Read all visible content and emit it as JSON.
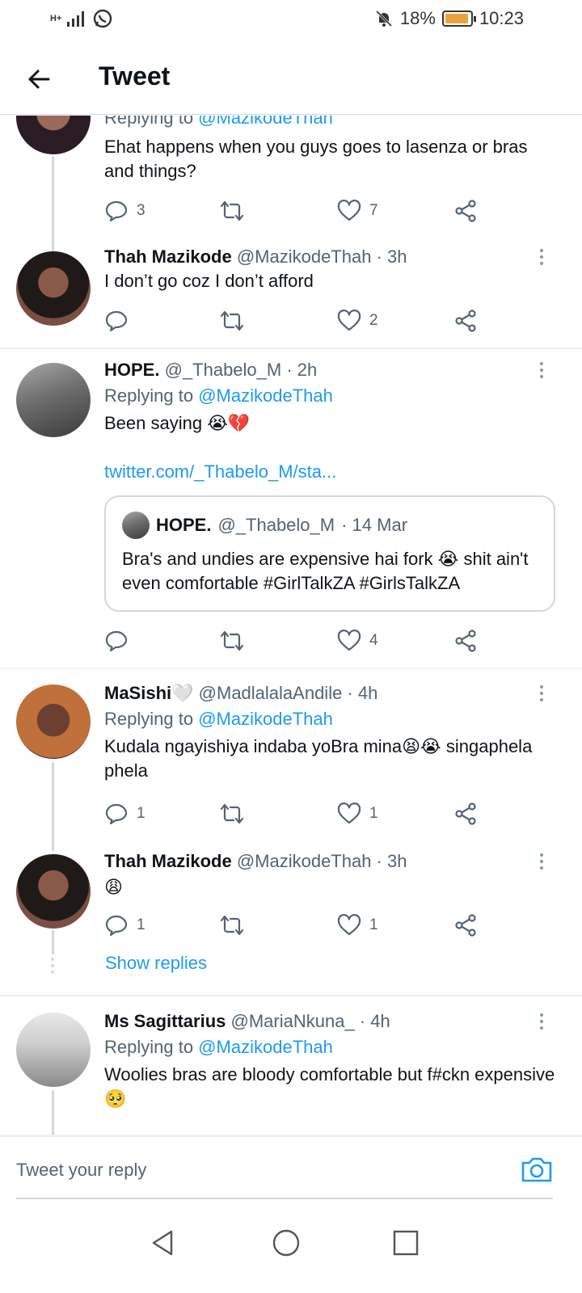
{
  "status_bar": {
    "network": "H+",
    "battery_percent": "18%",
    "time": "10:23"
  },
  "header": {
    "title": "Tweet"
  },
  "tweets": [
    {
      "replying_to": "Replying to",
      "replying_handle": "@MazikodeThah",
      "text": "Ehat happens when you guys goes to lasenza or bras and things?",
      "replies": "3",
      "retweets": "",
      "likes": "7"
    },
    {
      "name": "Thah Mazikode",
      "handle": "@MazikodeThah",
      "time": "· 3h",
      "text": "I don’t go coz I don’t afford",
      "replies": "",
      "retweets": "",
      "likes": "2"
    },
    {
      "name": "HOPE.",
      "handle": "@_Thabelo_M",
      "time": "· 2h",
      "replying_to": "Replying to",
      "replying_handle": "@MazikodeThah",
      "text": "Been saying 😭💔",
      "link": "twitter.com/_Thabelo_M/sta...",
      "quote": {
        "name": "HOPE.",
        "handle": "@_Thabelo_M",
        "time": "· 14 Mar",
        "text": "Bra's and undies are expensive hai fork 😭 shit ain't even comfortable #GirlTalkZA #GirlsTalkZA"
      },
      "replies": "",
      "retweets": "",
      "likes": "4"
    },
    {
      "name": "MaSishi🤍",
      "handle": "@MadlalalaAndile",
      "time": "· 4h",
      "replying_to": "Replying to",
      "replying_handle": "@MazikodeThah",
      "text": "Kudala ngayishiya indaba yoBra mina😫😭 singaphela phela",
      "replies": "1",
      "retweets": "",
      "likes": "1"
    },
    {
      "name": "Thah Mazikode",
      "handle": "@MazikodeThah",
      "time": "· 3h",
      "text": "😩",
      "replies": "1",
      "retweets": "",
      "likes": "1",
      "show_replies": "Show replies"
    },
    {
      "name": "Ms Sagittarius",
      "handle": "@MariaNkuna_",
      "time": "· 4h",
      "replying_to": "Replying to",
      "replying_handle": "@MazikodeThah",
      "text": "Woolies bras are bloody comfortable but f#ckn expensive 🥺"
    }
  ],
  "composer": {
    "placeholder": "Tweet your reply"
  },
  "colors": {
    "accent": "#1d9bf0",
    "text": "#0f1419",
    "muted": "#536471",
    "border": "#cfd9de"
  },
  "icons": [
    "back-arrow-icon",
    "reply-icon",
    "retweet-icon",
    "heart-icon",
    "share-icon",
    "more-icon",
    "camera-icon",
    "nav-back-icon",
    "nav-home-icon",
    "nav-recents-icon"
  ]
}
